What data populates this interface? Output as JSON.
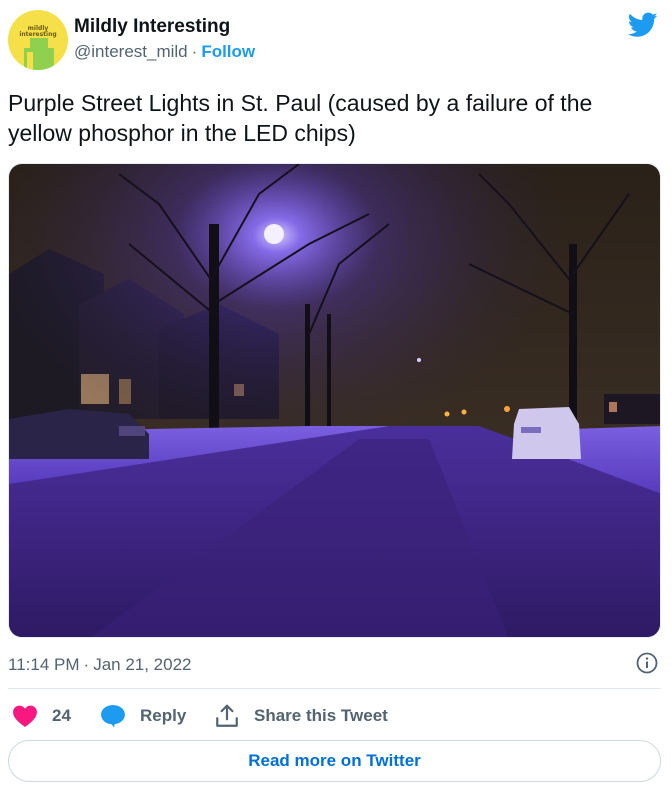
{
  "author": {
    "name": "Mildly Interesting",
    "handle": "@interest_mild",
    "separator": "·",
    "follow_label": "Follow",
    "avatar_text": "mildly interesting",
    "avatar_color": "#f5e04a"
  },
  "tweet": {
    "text": "Purple Street Lights in St. Paul (caused by a failure of the yellow phosphor in the LED chips)",
    "time": "11:14 PM",
    "separator": "·",
    "date": "Jan 21, 2022"
  },
  "photo": {
    "description_icon": "photo-purple-street-lights"
  },
  "actions": {
    "like_count": "24",
    "reply_label": "Reply",
    "share_label": "Share this Tweet"
  },
  "footer": {
    "read_more_label": "Read more on Twitter"
  },
  "colors": {
    "accent": "#1d9bf0",
    "link": "#006fd6",
    "like": "#f91880",
    "text_secondary": "#536471"
  },
  "icons": [
    "twitter-bird-icon",
    "info-icon",
    "heart-icon",
    "reply-bubble-icon",
    "share-icon"
  ]
}
